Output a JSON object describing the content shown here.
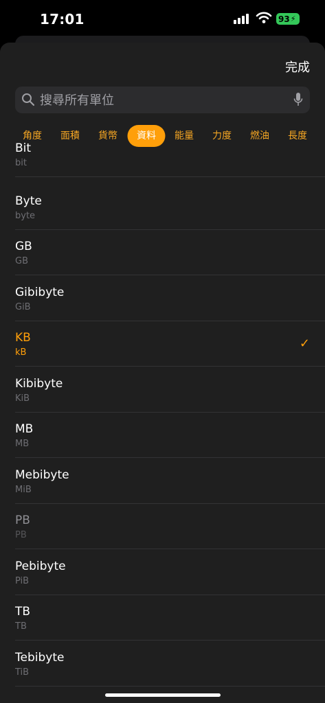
{
  "status": {
    "time": "17:01",
    "battery": "93"
  },
  "header": {
    "done_label": "完成"
  },
  "search": {
    "placeholder": "搜尋所有單位"
  },
  "tabs": [
    {
      "label": "角度"
    },
    {
      "label": "面積"
    },
    {
      "label": "貨幣"
    },
    {
      "label": "資料"
    },
    {
      "label": "能量"
    },
    {
      "label": "力度"
    },
    {
      "label": "燃油"
    },
    {
      "label": "長度"
    }
  ],
  "units": [
    {
      "name": "Bit",
      "symbol": "bit"
    },
    {
      "name": "Byte",
      "symbol": "byte"
    },
    {
      "name": "GB",
      "symbol": "GB"
    },
    {
      "name": "Gibibyte",
      "symbol": "GiB"
    },
    {
      "name": "KB",
      "symbol": "kB"
    },
    {
      "name": "Kibibyte",
      "symbol": "KiB"
    },
    {
      "name": "MB",
      "symbol": "MB"
    },
    {
      "name": "Mebibyte",
      "symbol": "MiB"
    },
    {
      "name": "PB",
      "symbol": "PB"
    },
    {
      "name": "Pebibyte",
      "symbol": "PiB"
    },
    {
      "name": "TB",
      "symbol": "TB"
    },
    {
      "name": "Tebibyte",
      "symbol": "TiB"
    }
  ],
  "colors": {
    "accent": "#ff9f0a",
    "sheet": "#1f1f1f",
    "battery": "#34c759"
  }
}
